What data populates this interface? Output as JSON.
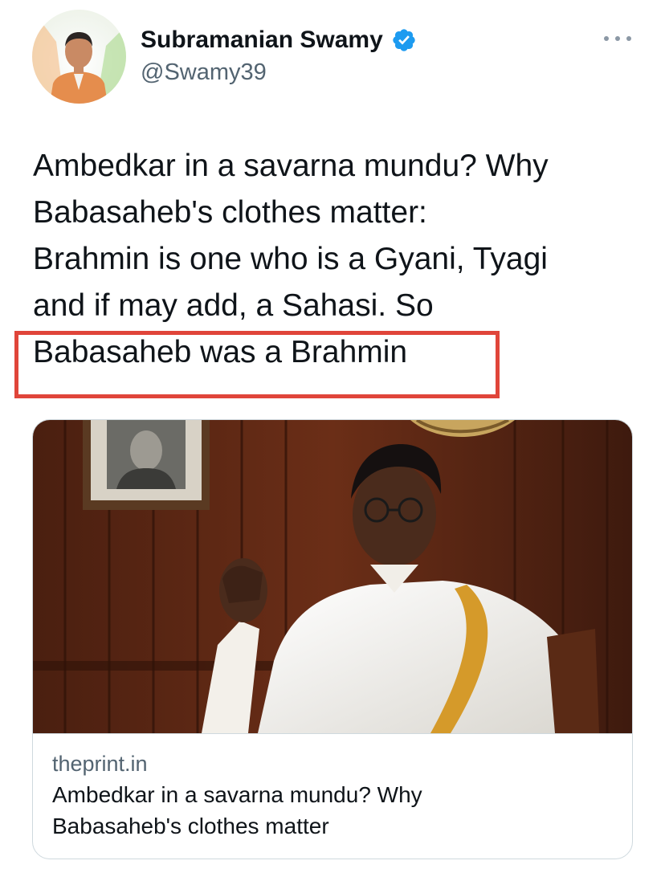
{
  "author": {
    "display_name": "Subramanian Swamy",
    "handle": "@Swamy39",
    "verified": true,
    "verified_color": "#1d9bf0"
  },
  "tweet": {
    "text_lines": [
      "Ambedkar in a savarna mundu? Why",
      "Babasaheb's clothes matter:",
      "Brahmin is one who is a Gyani, Tyagi",
      "and if may add, a Sahasi. So",
      "Babasaheb was a Brahmin"
    ],
    "highlight_color": "#e0453a"
  },
  "link_card": {
    "domain": "theprint.in",
    "title_lines": [
      "Ambedkar in a savarna mundu? Why",
      "Babasaheb's clothes matter"
    ]
  },
  "icons": {
    "verified": "verified-badge-icon",
    "more": "more-options-icon"
  }
}
